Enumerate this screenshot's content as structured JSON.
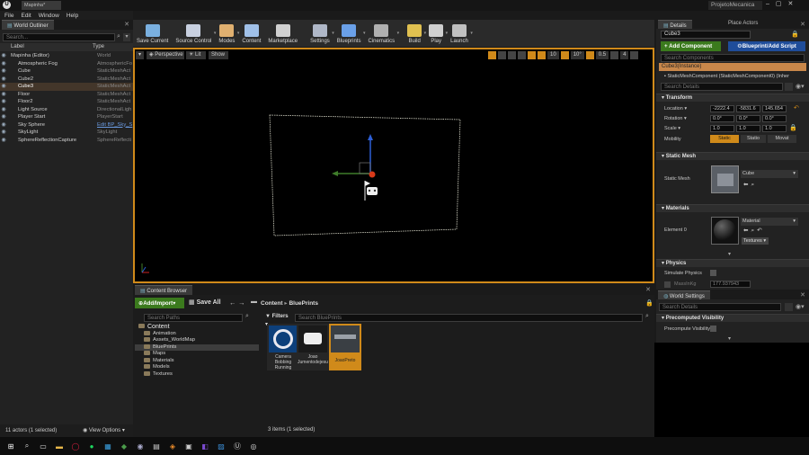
{
  "window": {
    "tab_label": "Mapinha*",
    "project_name": "ProjetoMecanica"
  },
  "menu": [
    "File",
    "Edit",
    "Window",
    "Help"
  ],
  "toolbar": [
    {
      "label": "Save Current",
      "icon": "save-icon",
      "dd": false
    },
    {
      "label": "Source Control",
      "icon": "source-control-icon",
      "dd": true
    },
    {
      "label": "Modes",
      "icon": "modes-icon",
      "dd": true
    },
    {
      "label": "Content",
      "icon": "content-icon",
      "dd": false
    },
    {
      "label": "Marketplace",
      "icon": "marketplace-icon",
      "dd": false
    },
    {
      "label": "Settings",
      "icon": "settings-icon",
      "dd": true
    },
    {
      "label": "Blueprints",
      "icon": "blueprints-icon",
      "dd": true
    },
    {
      "label": "Cinematics",
      "icon": "cinematics-icon",
      "dd": true
    },
    {
      "label": "Build",
      "icon": "build-icon",
      "dd": true
    },
    {
      "label": "Play",
      "icon": "play-icon",
      "dd": true
    },
    {
      "label": "Launch",
      "icon": "launch-icon",
      "dd": true
    }
  ],
  "outliner": {
    "tab": "World Outliner",
    "search_placeholder": "Search...",
    "col_label": "Label",
    "col_type": "Type",
    "rows": [
      {
        "name": "Mapinha (Editor)",
        "type": "World",
        "indent": 0,
        "selected": false
      },
      {
        "name": "Atmospheric Fog",
        "type": "AtmosphericFo",
        "indent": 1,
        "selected": false
      },
      {
        "name": "Cube",
        "type": "StaticMeshAct",
        "indent": 1,
        "selected": false
      },
      {
        "name": "Cube2",
        "type": "StaticMeshAct",
        "indent": 1,
        "selected": false
      },
      {
        "name": "Cube3",
        "type": "StaticMeshAct",
        "indent": 1,
        "selected": true
      },
      {
        "name": "Floor",
        "type": "StaticMeshAct",
        "indent": 1,
        "selected": false
      },
      {
        "name": "Floor2",
        "type": "StaticMeshAct",
        "indent": 1,
        "selected": false
      },
      {
        "name": "Light Source",
        "type": "DirectionalLigh",
        "indent": 1,
        "selected": false
      },
      {
        "name": "Player Start",
        "type": "PlayerStart",
        "indent": 1,
        "selected": false
      },
      {
        "name": "Sky Sphere",
        "type": "Edit BP_Sky_S",
        "indent": 1,
        "selected": false
      },
      {
        "name": "SkyLight",
        "type": "SkyLight",
        "indent": 1,
        "selected": false
      },
      {
        "name": "SphereReflectionCapture",
        "type": "SphereReflecti",
        "indent": 1,
        "selected": false
      }
    ],
    "footer_count": "11 actors (1 selected)",
    "view_options": "View Options"
  },
  "viewport": {
    "perspective": "Perspective",
    "lit": "Lit",
    "show": "Show",
    "grid_snap": "10",
    "rot_snap": "10°",
    "scale_snap": "0.5",
    "cam_speed": "4"
  },
  "details": {
    "tab_details": "Details",
    "tab_place": "Place Actors",
    "actor_name": "Cube3",
    "add_component": "+ Add Component",
    "blueprint_btn": "Blueprint/Add Script",
    "search_components": "Search Components",
    "instance_row": "Cube3(Instance)",
    "component_row": "StaticMeshComponent (StaticMeshComponent0) (Inher",
    "search_details": "Search Details",
    "transform": {
      "header": "Transform",
      "location_label": "Location",
      "location": [
        "-2222.4",
        "-5831.6",
        "145.654"
      ],
      "rotation_label": "Rotation",
      "rotation": [
        "0.0°",
        "0.0°",
        "0.0°"
      ],
      "scale_label": "Scale",
      "scale": [
        "1.0",
        "1.0",
        "1.0"
      ],
      "mobility_label": "Mobility",
      "mobility": [
        "Static",
        "Statio",
        "Movat"
      ]
    },
    "static_mesh": {
      "header": "Static Mesh",
      "label": "Static Mesh",
      "value": "Cube"
    },
    "materials": {
      "header": "Materials",
      "label": "Element 0",
      "value": "Material",
      "textures": "Textures"
    },
    "physics": {
      "header": "Physics",
      "simulate": "Simulate Physics",
      "mass_label": "MassInKg",
      "mass": "177.937943"
    }
  },
  "world_settings": {
    "tab": "World Settings",
    "search": "Search Details",
    "precomputed_header": "Precomputed Visibility",
    "precompute_label": "Precompute Visibility"
  },
  "content_browser": {
    "tab": "Content Browser",
    "add_import": "Add/Import",
    "save_all": "Save All",
    "path": [
      "Content",
      "BluePrints"
    ],
    "search_paths": "Search Paths",
    "filters": "Filters",
    "search_assets": "Search BluePrints",
    "tree": [
      {
        "name": "Content",
        "indent": 0,
        "selected": false,
        "root": true
      },
      {
        "name": "Animation",
        "indent": 1,
        "selected": false
      },
      {
        "name": "Assets_WorldMap",
        "indent": 1,
        "selected": false
      },
      {
        "name": "BluePrints",
        "indent": 1,
        "selected": true
      },
      {
        "name": "Maps",
        "indent": 1,
        "selected": false
      },
      {
        "name": "Materials",
        "indent": 1,
        "selected": false
      },
      {
        "name": "Models",
        "indent": 1,
        "selected": false
      },
      {
        "name": "Textures",
        "indent": 1,
        "selected": false
      }
    ],
    "assets": [
      {
        "name": "Camera Bobbing Running",
        "selected": false
      },
      {
        "name": "Joao Jumentodejesu",
        "selected": false
      },
      {
        "name": "JoaoPreto",
        "selected": true
      }
    ],
    "footer": "3 items (1 selected)"
  },
  "colors": {
    "accent_orange": "#d08a1a",
    "selection": "#c8874a",
    "green_btn": "#3b7a1d",
    "blue_btn": "#1f4d9a"
  }
}
